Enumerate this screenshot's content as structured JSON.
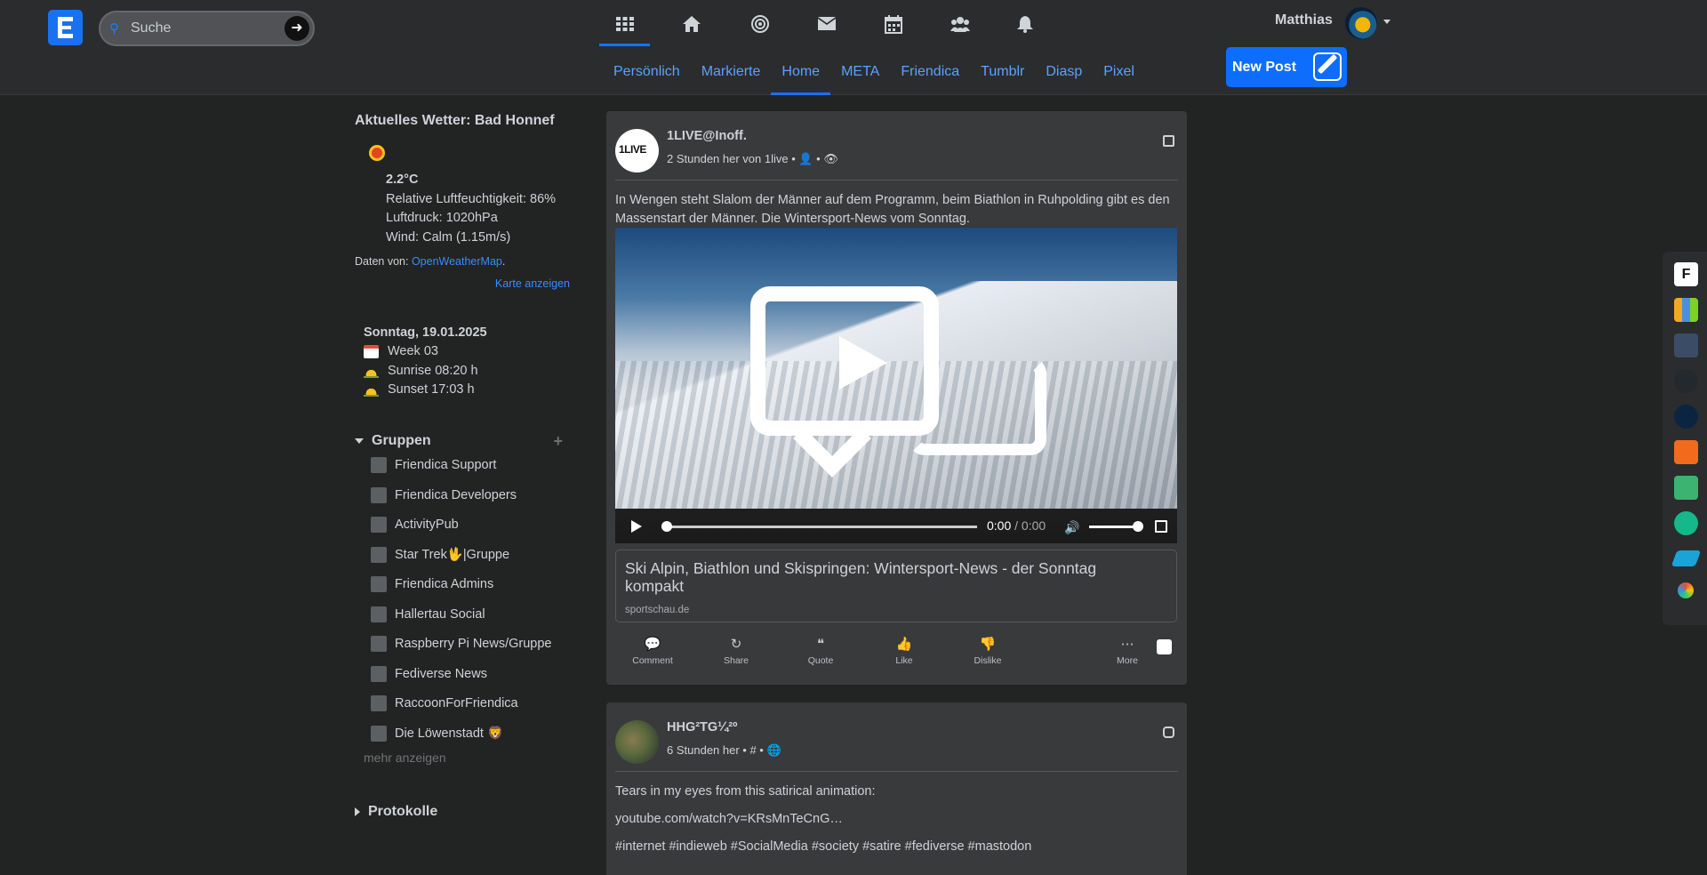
{
  "search": {
    "placeholder": "Suche"
  },
  "nav": {
    "icons": [
      "apps-icon",
      "home-icon",
      "network-icon",
      "mail-icon",
      "calendar-icon",
      "contacts-icon",
      "notifications-icon"
    ],
    "tabs": [
      "Persönlich",
      "Markierte",
      "Home",
      "META",
      "Friendica",
      "Tumblr",
      "Diasp",
      "Pixel"
    ],
    "active_tab": "Home",
    "new_post": "New Post"
  },
  "user": {
    "name": "Matthias"
  },
  "weather": {
    "title": "Aktuelles Wetter: Bad Honnef",
    "temp": "2.2°C",
    "humidity": "Relative Luftfeuchtigkeit: 86%",
    "pressure": "Luftdruck: 1020hPa",
    "wind": "Wind: Calm (1.15m/s)",
    "source_prefix": "Daten von: ",
    "source_link": "OpenWeatherMap",
    "source_suffix": ".",
    "map_link": "Karte anzeigen"
  },
  "date": {
    "title": "Sonntag, 19.01.2025",
    "week": "Week 03",
    "sunrise": "Sunrise 08:20 h",
    "sunset": "Sunset 17:03 h"
  },
  "groups": {
    "title": "Gruppen",
    "items": [
      {
        "label": "Friendica Support"
      },
      {
        "label": "Friendica Developers"
      },
      {
        "label": "ActivityPub"
      },
      {
        "label": "Star Trek🖖|Gruppe"
      },
      {
        "label": "Friendica Admins"
      },
      {
        "label": "Hallertau Social"
      },
      {
        "label": "Raspberry Pi News/Gruppe"
      },
      {
        "label": "Fediverse News"
      },
      {
        "label": "RaccoonForFriendica"
      },
      {
        "label": "Die Löwenstadt 🦁"
      }
    ],
    "more": "mehr anzeigen"
  },
  "protocols": {
    "title": "Protokolle"
  },
  "post1": {
    "author": "1LIVE@Inoff.",
    "meta": "2 Stunden her von 1live • 👤 •",
    "text": "In Wengen steht Slalom der Männer auf dem Programm, beim Biathlon in Ruhpolding gibt es den Massenstart der Männer. Die Wintersport-News vom Sonntag.",
    "video_time_current": "0:00",
    "video_time_total": " / 0:00",
    "link_title": "Ski Alpin, Biathlon und Skispringen: Wintersport-News - der Sonntag kompakt",
    "link_host": "sportschau.de",
    "actions": [
      "Comment",
      "Share",
      "Quote",
      "Like",
      "Dislike",
      "More"
    ]
  },
  "post2": {
    "author": "HHG²TG¼²º",
    "meta": "6 Stunden her • # •",
    "text1": "Tears in my eyes from this satirical animation:",
    "text2": "youtube.com/watch?v=KRsMnTeCnG…",
    "text3": "#internet #indieweb #SocialMedia #society #satire #fediverse #mastodon"
  },
  "dock": {
    "apps": [
      "friendica-app",
      "stats-app",
      "mastodon-app",
      "github-app",
      "deviant-app",
      "podcast-app",
      "pixelfed-app",
      "lemmy-app",
      "bluesky-app",
      "misc-app"
    ]
  },
  "colors": {
    "accent": "#1872f0",
    "link": "#3a8bff",
    "tab_link": "#5ba2ff",
    "card": "#393a3c",
    "bg": "#222323"
  }
}
